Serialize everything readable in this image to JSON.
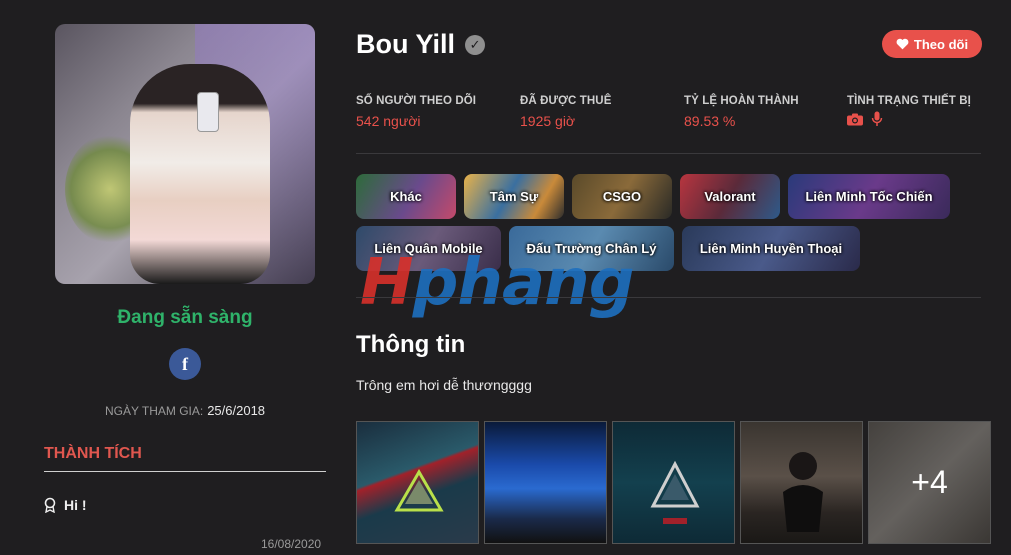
{
  "profile": {
    "name": "Bou Yill",
    "status": "Đang sẵn sàng",
    "joined_label": "NGÀY THAM GIA:",
    "joined_date": "25/6/2018",
    "follow_label": "Theo dõi",
    "facebook_icon": "f"
  },
  "stats": {
    "followers": {
      "label": "SỐ NGƯỜI THEO DÕI",
      "value": "542 người"
    },
    "hired": {
      "label": "ĐÃ ĐƯỢC THUÊ",
      "value": "1925 giờ"
    },
    "completion": {
      "label": "TỶ LỆ HOÀN THÀNH",
      "value": "89.53 %"
    },
    "devices": {
      "label": "TÌNH TRẠNG THIẾT BỊ",
      "icons": [
        "camera-icon",
        "microphone-icon"
      ]
    }
  },
  "games": [
    "Khác",
    "Tâm Sự",
    "CSGO",
    "Valorant",
    "Liên Minh Tốc Chiến",
    "Liên Quân Mobile",
    "Đấu Trường Chân Lý",
    "Liên Minh Huyền Thoại"
  ],
  "watermark": {
    "part1": "H",
    "part2": "phang"
  },
  "info": {
    "title": "Thông tin",
    "bio": "Trông em hơi dễ thươngggg"
  },
  "gallery": {
    "more_label": "+4"
  },
  "achievements": {
    "title": "THÀNH TÍCH",
    "items": [
      {
        "label": "Hi !",
        "date": "16/08/2020"
      }
    ]
  },
  "colors": {
    "accent": "#e8514b",
    "status": "#2fb36a",
    "facebook": "#3b5998",
    "background": "#1f1e20"
  }
}
